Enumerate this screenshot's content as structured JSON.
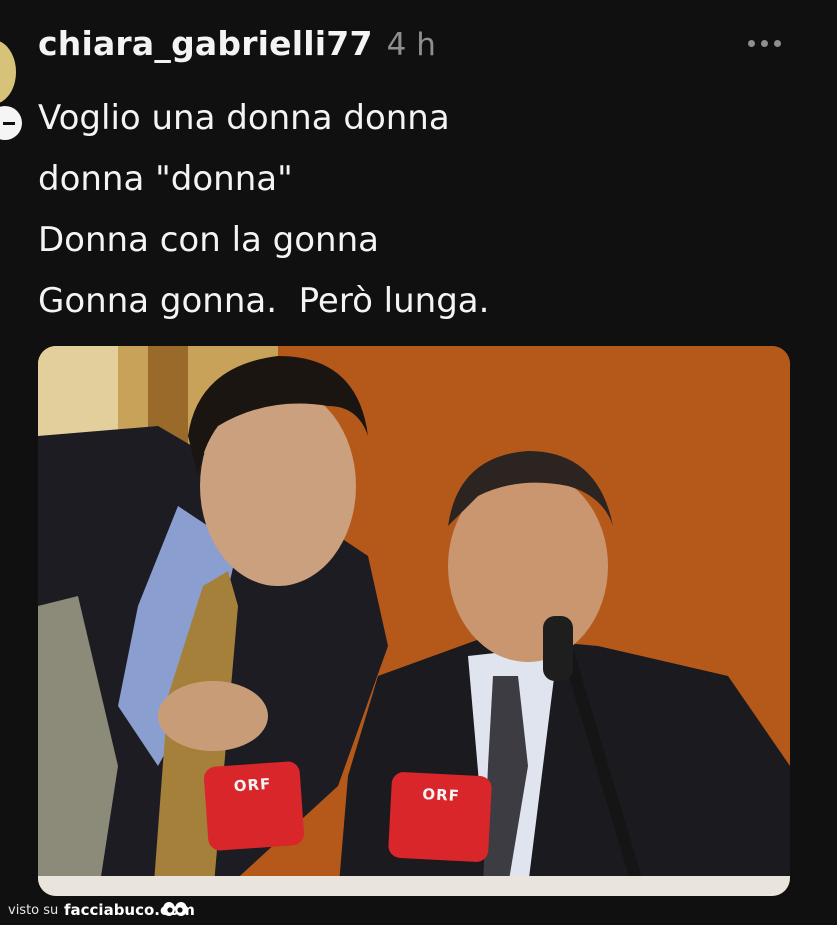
{
  "post": {
    "username": "chiara_gabrielli77",
    "timestamp": "4 h",
    "lines": [
      "Voglio una donna donna",
      "donna \"donna\"",
      "Donna con la gonna",
      "Gonna gonna.  Però lunga."
    ]
  },
  "photo": {
    "microphone_labels": [
      "ORF",
      "ORF"
    ]
  },
  "footer": {
    "visto_su": "visto su",
    "site": "facciabuco.com"
  },
  "icons": {
    "more": "more-options-icon",
    "watermark": "eyes-icon"
  },
  "colors": {
    "background": "#101010",
    "text": "#f4f4f4",
    "muted": "#8f8f8f",
    "photo_backdrop": "#b45a1c",
    "mic_red": "#d8262b"
  }
}
